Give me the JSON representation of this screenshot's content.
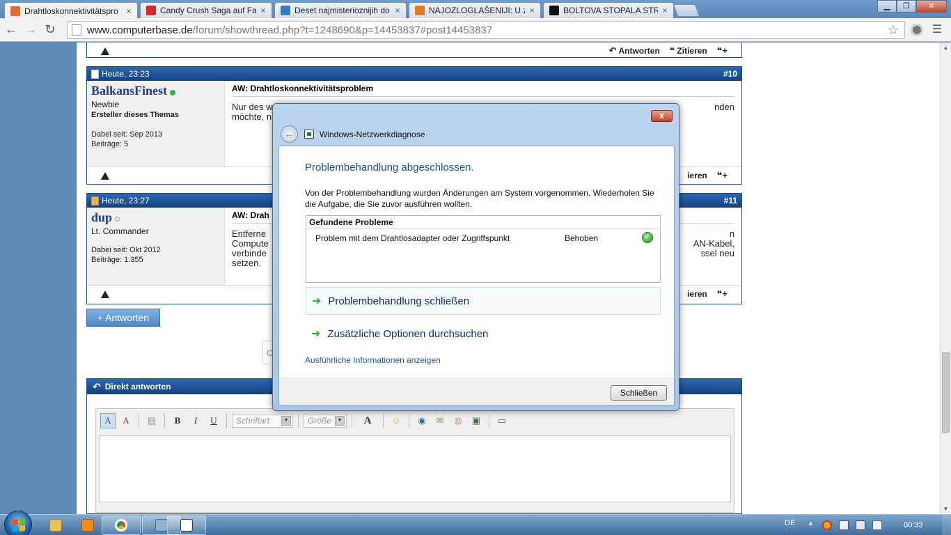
{
  "browser": {
    "tabs": [
      {
        "title": "Drahtloskonnektivitätspro",
        "icon": "computerbase-favicon",
        "color": "#e8672b",
        "active": true
      },
      {
        "title": "Candy Crush Saga auf Fac",
        "icon": "candy-crush-favicon",
        "color": "#d22a2a",
        "active": false
      },
      {
        "title": "Deset najmisterioznijih do",
        "icon": "blue-loop-favicon",
        "color": "#3a78c2",
        "active": false
      },
      {
        "title": "NAJOZLOGLAŠENIJI: U zat",
        "icon": "orange-favicon",
        "color": "#e07a22",
        "active": false
      },
      {
        "title": "BOLTOVA STOPALA STRA",
        "icon": "t-favicon",
        "color": "#111111",
        "active": false
      }
    ],
    "tab_close_glyph": "×",
    "window_controls": {
      "minimize": "▁",
      "maximize": "❐",
      "close": "✕"
    },
    "url_host": "www.computerbase.de",
    "url_path": "/forum/showthread.php?t=1248690&p=14453837#post14453837"
  },
  "forum": {
    "top_bar": {
      "reply": "Antworten",
      "quote": "Zitieren"
    },
    "posts": [
      {
        "time": "Heute, 23:23",
        "number": "#10",
        "username": "BalkansFinest",
        "online": true,
        "rank": "Newbie",
        "thread_starter": "Ersteller dieses Themas",
        "joined": "Dabei seit: Sep 2013",
        "posts_count": "Beiträge: 5",
        "title": "AW: Drahtloskonnektivitätsproblem",
        "text_left": "Nur des w",
        "text_left2": "möchte, n",
        "text_right": "nden",
        "foot_right": "ieren"
      },
      {
        "time": "Heute, 23:27",
        "number": "#11",
        "username": "dup",
        "online": false,
        "rank": "Lt. Commander",
        "joined": "Dabei seit: Okt 2012",
        "posts_count": "Beiträge: 1.355",
        "title": "AW: Drah",
        "text_left_lines": [
          "Entferne",
          "Compute",
          "verbinde",
          "setzen."
        ],
        "text_right_lines": [
          "n",
          "AN-Kabel,",
          "ssel neu"
        ],
        "foot_right": "ieren"
      }
    ],
    "reply_button": "+ Antworten",
    "search_fragment": "C",
    "quick_reply": {
      "title": "Direkt antworten",
      "font_placeholder": "Schriftart",
      "size_placeholder": "Größe",
      "bold": "B",
      "italic": "I",
      "underline": "U",
      "font_color": "A"
    }
  },
  "dialog": {
    "window_title": "Windows-Netzwerkdiagnose",
    "heading": "Problembehandlung abgeschlossen.",
    "description": "Von der Problembehandlung wurden Änderungen am System vorgenommen. Wiederholen Sie die Aufgabe, die Sie zuvor ausführen wollten.",
    "found_title": "Gefundene Probleme",
    "problem": "Problem mit dem Drahtlosadapter oder Zugriffspunkt",
    "status": "Behoben",
    "option_close": "Problembehandlung schließen",
    "option_more": "Zusätzliche Optionen durchsuchen",
    "details_link": "Ausführliche Informationen anzeigen",
    "close_button": "Schließen",
    "close_glyph": "x",
    "back_glyph": "←",
    "arrow_glyph": "➜",
    "check_glyph": "✓"
  },
  "taskbar": {
    "language": "DE",
    "clock": "00:33",
    "tray_up_glyph": "▲"
  },
  "colors": {
    "accent": "#1f4e8c",
    "dialog_heading": "#1f4e99",
    "link": "#1f56b0",
    "success": "#2c9a2c"
  }
}
